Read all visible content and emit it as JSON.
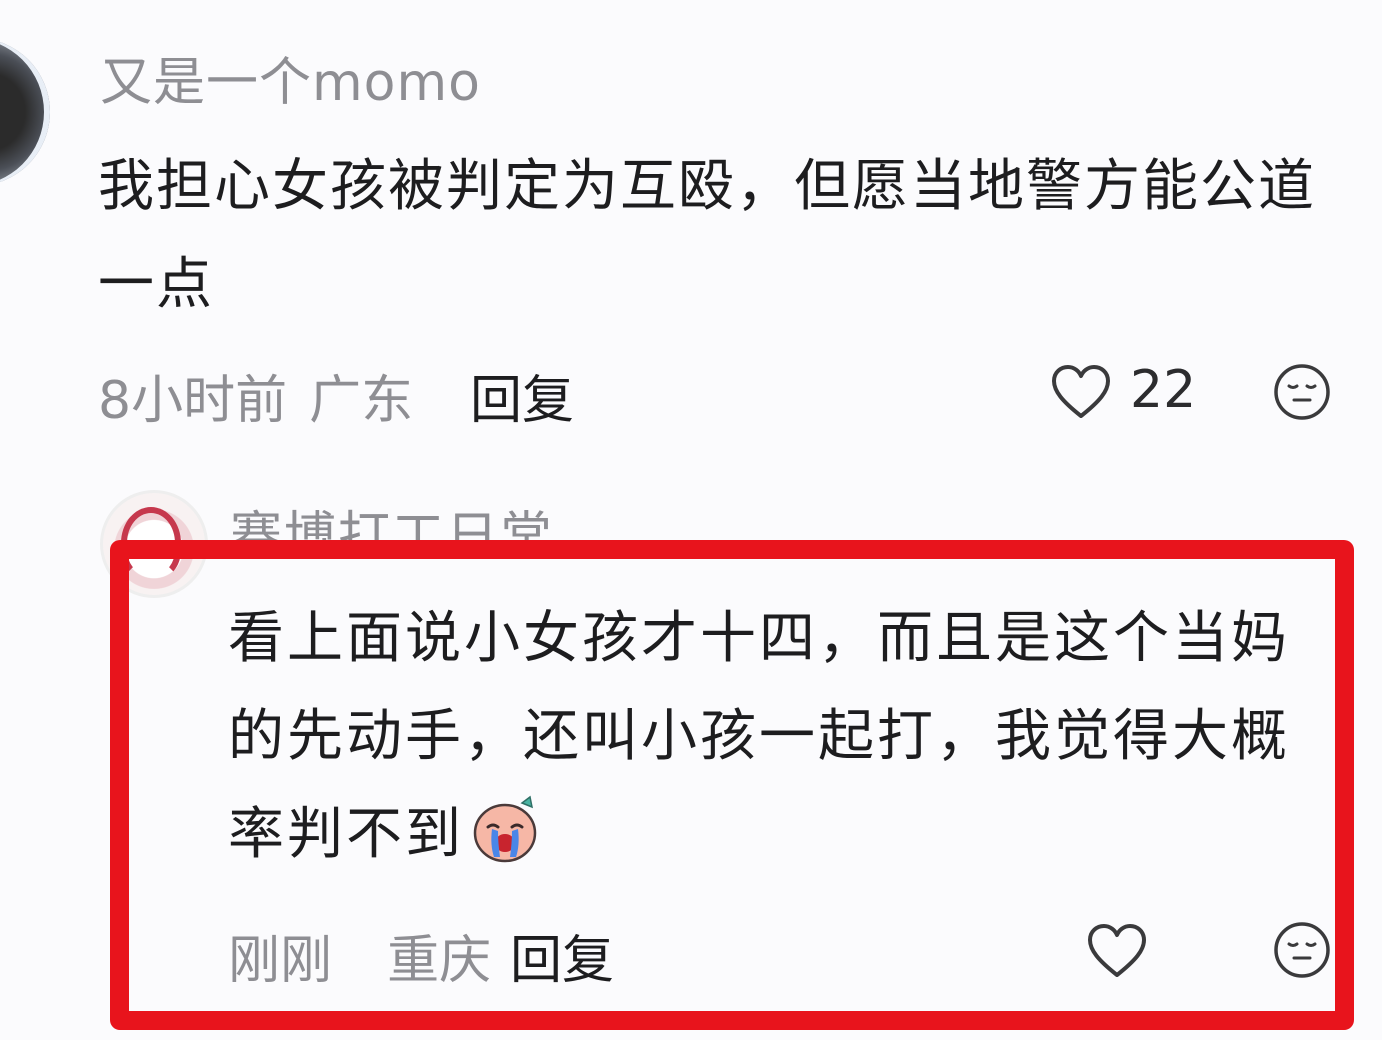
{
  "comments": [
    {
      "username": "又是一个momo",
      "text": "我担心女孩被判定为互殴，但愿当地警方能公道一点",
      "time": "8小时前",
      "location": "广东",
      "reply_label": "回复",
      "like_count": "22",
      "icons": [
        "heart-icon",
        "neutral-face-icon"
      ]
    },
    {
      "username": "赛博打工日常",
      "text": "看上面说小女孩才十四，而且是这个当妈的先动手，还叫小孩一起打，我觉得大概率判不到",
      "emoji": "sob-emoji",
      "time": "刚刚",
      "location": "重庆",
      "reply_label": "回复",
      "icons": [
        "heart-icon",
        "neutral-face-icon"
      ]
    }
  ],
  "highlight_color": "#e8141c"
}
